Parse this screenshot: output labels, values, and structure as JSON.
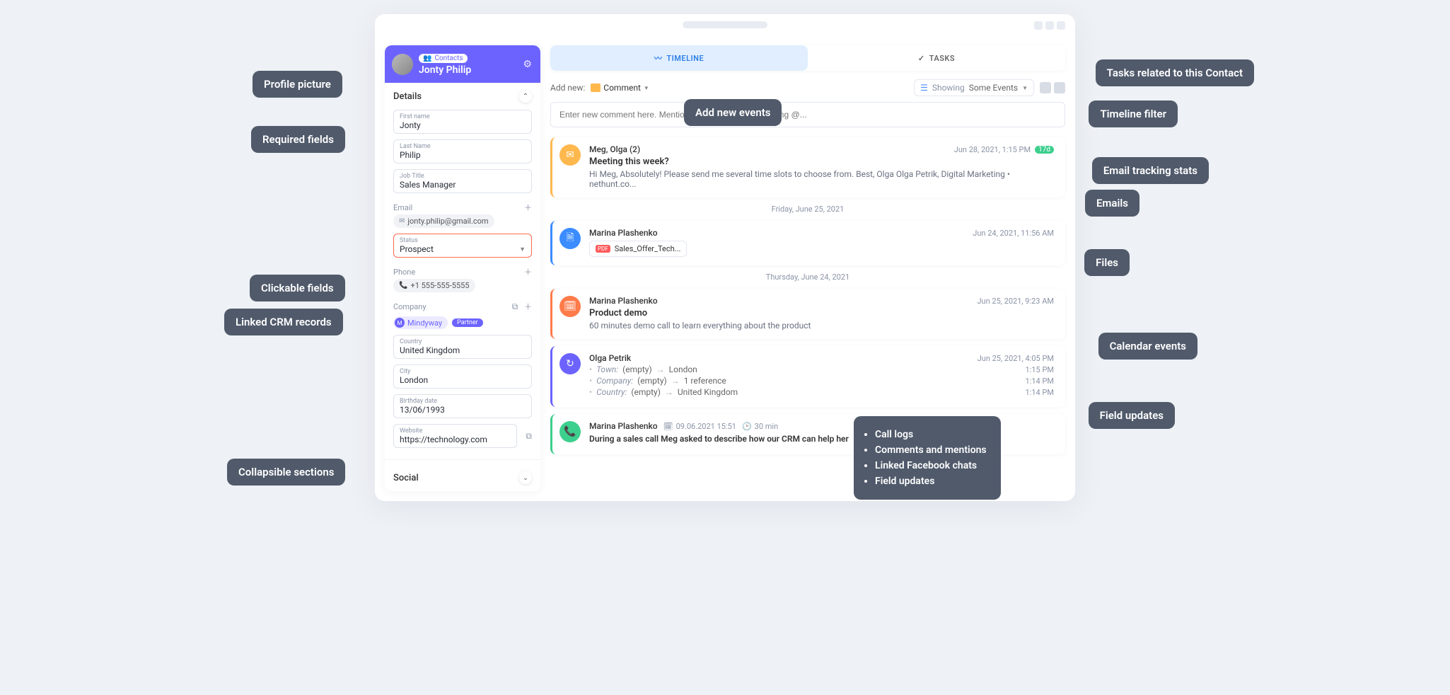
{
  "profile": {
    "chip_label": "Contacts",
    "name": "Jonty Philip"
  },
  "details": {
    "section_label": "Details",
    "first_name_label": "First name",
    "first_name": "Jonty",
    "last_name_label": "Last Name",
    "last_name": "Philip",
    "job_title_label": "Job Title",
    "job_title": "Sales Manager",
    "email_label": "Email",
    "email": "jonty.philip@gmail.com",
    "status_label": "Status",
    "status": "Prospect",
    "phone_label": "Phone",
    "phone": "+1 555-555-5555",
    "company_label": "Company",
    "company_name": "Mindyway",
    "company_tag": "Partner",
    "country_label": "Country",
    "country": "United Kingdom",
    "city_label": "City",
    "city": "London",
    "birthday_label": "Birthday date",
    "birthday": "13/06/1993",
    "website_label": "Website",
    "website": "https://technology.com",
    "social_label": "Social"
  },
  "tabs": {
    "timeline": "TIMELINE",
    "tasks": "TASKS"
  },
  "toolbar": {
    "add_new": "Add new:",
    "comment": "Comment",
    "showing": "Showing",
    "some_events": "Some Events",
    "placeholder": "Enter new comment here. Mention your teammates by typing @..."
  },
  "events": {
    "email": {
      "author": "Meg, Olga (2)",
      "date": "Jun 28, 2021, 1:15 PM",
      "badge": "17d",
      "title": "Meeting this week?",
      "body": "Hi Meg, Absolutely! Please send me several time slots to choose from. Best, Olga Olga Petrik, Digital Marketing • nethunt.co..."
    },
    "sep1": "Friday, June 25, 2021",
    "file": {
      "author": "Marina Plashenko",
      "date": "Jun 24, 2021, 11:56 AM",
      "filename": "Sales_Offer_Tech..."
    },
    "sep2": "Thursday, June 24, 2021",
    "cal": {
      "author": "Marina Plashenko",
      "date": "Jun 25, 2021, 9:23 AM",
      "title": "Product demo",
      "body": "60 minutes demo call to learn everything about the product"
    },
    "hist": {
      "author": "Olga Petrik",
      "date": "Jun 25, 2021, 4:05 PM",
      "lines": [
        {
          "field": "Town:",
          "from": "(empty)",
          "to": "London",
          "time": "1:15 PM"
        },
        {
          "field": "Company:",
          "from": "(empty)",
          "to": "1 reference",
          "time": "1:14 PM"
        },
        {
          "field": "Country:",
          "from": "(empty)",
          "to": "United Kingdom",
          "time": "1:14 PM"
        }
      ]
    },
    "call": {
      "author": "Marina Plashenko",
      "datetime": "09.06.2021 15:51",
      "duration": "30 min",
      "body": "During a sales call Meg asked to describe how our CRM can help her"
    }
  },
  "callouts": {
    "left": {
      "profile": "Profile picture",
      "required": "Required fields",
      "clickable": "Clickable fields",
      "linked": "Linked CRM records",
      "collapsible": "Collapsible sections"
    },
    "right": {
      "tasks": "Tasks related to this Contact",
      "filter": "Timeline filter",
      "tracking": "Email tracking stats",
      "emails": "Emails",
      "files": "Files",
      "calendar": "Calendar events",
      "updates": "Field updates"
    },
    "center": {
      "add_new": "Add new events"
    },
    "list": [
      "Call logs",
      "Comments and mentions",
      "Linked Facebook chats",
      "Field updates"
    ]
  }
}
